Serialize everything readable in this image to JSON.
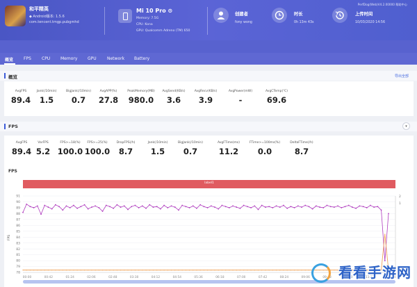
{
  "header": {
    "app_name": "和平精英",
    "app_version": "◆ Android版本: 1.5.6",
    "app_package": "com.tencent.tmgp.pubgmhd",
    "device_name": "Mi 10 Pro ⊙",
    "memory": "Memory: 7.5G",
    "cpu": "CPU: Kona",
    "gpu": "GPU: Qualcomm Adreno (TM) 650",
    "creator_label": "创建者",
    "creator_value": "fony wong",
    "duration_label": "时长",
    "duration_value": "0h 13m 43s",
    "upload_label": "上传时间",
    "upload_value": "10/03/2020 14:56",
    "version_info": "PerfDog(Web)V4.2.00000 帮助中心"
  },
  "tabs": [
    {
      "label": "概览"
    },
    {
      "label": "FPS"
    },
    {
      "label": "CPU"
    },
    {
      "label": "Memory"
    },
    {
      "label": "GPU"
    },
    {
      "label": "Network"
    },
    {
      "label": "Battery"
    }
  ],
  "overview": {
    "title": "概览",
    "export": "导出全部",
    "stats": [
      {
        "label": "AvgFPS",
        "value": "89.4"
      },
      {
        "label": "Jank(/10min)",
        "value": "1.5"
      },
      {
        "label": "BigJank(/10min)",
        "value": "0.7"
      },
      {
        "label": "AvgAPP(%)",
        "value": "27.8"
      },
      {
        "label": "PeakMemory(MB)",
        "value": "980.0"
      },
      {
        "label": "AvgSend(KB/s)",
        "value": "3.6"
      },
      {
        "label": "AvgRecv(KB/s)",
        "value": "3.9"
      },
      {
        "label": "AvgPower(mW)",
        "value": "-"
      },
      {
        "label": "AvgCTemp(℃)",
        "value": "69.6"
      }
    ]
  },
  "fps": {
    "title": "FPS",
    "stats": [
      {
        "label": "AvgFPS",
        "value": "89.4"
      },
      {
        "label": "VarFPS",
        "value": "5.2"
      },
      {
        "label": "FPS>=18(%)",
        "value": "100.0"
      },
      {
        "label": "FPS>=25(%)",
        "value": "100.0"
      },
      {
        "label": "DropFPS(/h)",
        "value": "8.7"
      },
      {
        "label": "Jank(/10min)",
        "value": "1.5"
      },
      {
        "label": "BigJank(/10min)",
        "value": "0.7"
      },
      {
        "label": "AvgFTime(ms)",
        "value": "11.2"
      },
      {
        "label": "FTime>=100ms(%)",
        "value": "0.0"
      },
      {
        "label": "DeltaFTime(/h)",
        "value": "8.7"
      }
    ]
  },
  "chart_data": {
    "type": "line",
    "title": "FPS",
    "label_bar": "label1",
    "ylabel": "FPS",
    "ylim": [
      78,
      91
    ],
    "yticks": [
      91,
      90,
      89,
      88,
      87,
      86,
      85,
      84,
      83,
      82,
      81,
      80,
      79,
      78
    ],
    "y2ticks": [
      "2",
      "1"
    ],
    "xticks": [
      "00:00",
      "00:42",
      "01:24",
      "02:06",
      "02:48",
      "03:30",
      "04:12",
      "04:54",
      "05:36",
      "06:18",
      "07:00",
      "07:42",
      "08:24",
      "09:06",
      "09:48",
      "10:30",
      "11:12",
      "11:54"
    ],
    "series": [
      {
        "color": "#b03cbf",
        "values": [
          88.2,
          89.6,
          89.2,
          89.0,
          89.3,
          87.9,
          89.4,
          89.1,
          88.8,
          89.5,
          89.2,
          88.6,
          89.3,
          89.0,
          89.4,
          88.9,
          89.2,
          89.5,
          88.8,
          89.1,
          89.3,
          89.0,
          88.4,
          89.4,
          89.2,
          88.9,
          89.5,
          89.1,
          89.3,
          88.7,
          89.2,
          89.4,
          89.0,
          89.3,
          88.9,
          89.5,
          89.1,
          89.2,
          88.8,
          89.4,
          89.0,
          89.3,
          89.1,
          88.6,
          89.4,
          89.2,
          89.0,
          89.3,
          88.9,
          89.5,
          89.2,
          89.0,
          89.3,
          89.1,
          88.8,
          89.4,
          89.2,
          89.0,
          89.3,
          89.1,
          88.9,
          89.4,
          89.2,
          89.0,
          89.3,
          88.7,
          89.4,
          89.1,
          89.2,
          89.0,
          89.3,
          89.1,
          89.4,
          88.9,
          89.2,
          89.0,
          89.3,
          89.1,
          89.4,
          89.2,
          88.8,
          89.3,
          89.1,
          89.0,
          89.4,
          89.2,
          89.1,
          89.3,
          89.0,
          89.2,
          89.4,
          89.1,
          88.9,
          89.3,
          89.2,
          89.0,
          89.4,
          89.1,
          89.2,
          88.6,
          80.0,
          88.0
        ]
      },
      {
        "color": "#f0a35a",
        "values": [
          78.4,
          78.4,
          78.4,
          78.4,
          78.4,
          78.4,
          78.4,
          78.4,
          78.4,
          78.4,
          78.4,
          78.4,
          78.4,
          78.4,
          78.4,
          78.4,
          78.4,
          78.4,
          78.4,
          78.4,
          78.4,
          78.4,
          78.4,
          78.4,
          78.4,
          78.4,
          78.4,
          78.4,
          78.4,
          78.4,
          78.4,
          78.4,
          78.4,
          78.4,
          78.4,
          78.4,
          78.4,
          78.4,
          78.4,
          78.4,
          78.4,
          78.4,
          78.4,
          78.4,
          78.4,
          78.4,
          78.4,
          78.4,
          78.4,
          78.4,
          78.4,
          78.4,
          78.4,
          78.4,
          78.4,
          78.4,
          78.4,
          78.4,
          78.4,
          78.4,
          78.4,
          78.4,
          78.4,
          78.4,
          78.4,
          78.4,
          78.4,
          78.4,
          78.4,
          78.4,
          78.4,
          78.4,
          78.4,
          78.4,
          78.4,
          78.4,
          78.4,
          78.4,
          78.4,
          78.4,
          78.4,
          78.4,
          78.4,
          78.4,
          78.4,
          78.4,
          78.4,
          78.4,
          78.4,
          78.4,
          78.4,
          78.4,
          78.4,
          78.4,
          78.4,
          78.4,
          78.4,
          78.4,
          78.4,
          78.4,
          84.5,
          78.4
        ]
      }
    ]
  },
  "watermark": "看看手游网"
}
